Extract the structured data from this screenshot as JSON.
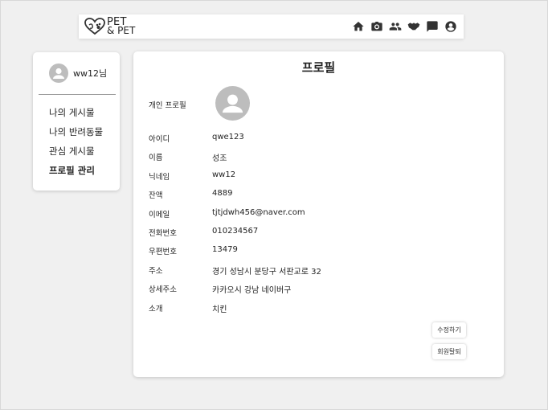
{
  "header": {
    "logo_line1": "PET",
    "logo_line2": "& PET",
    "icons": [
      "home-icon",
      "camera-box-icon",
      "people-icon",
      "handshake-icon",
      "chat-icon",
      "account-circle-icon"
    ]
  },
  "sidebar": {
    "username": "ww12님",
    "menu": [
      {
        "label": "나의 게시물",
        "active": false
      },
      {
        "label": "나의 반려동물",
        "active": false
      },
      {
        "label": "관심 게시물",
        "active": false
      },
      {
        "label": "프로필 관리",
        "active": true
      }
    ]
  },
  "profile": {
    "title": "프로필",
    "photo_label": "개인 프로필",
    "fields": [
      {
        "label": "아이디",
        "value": "qwe123"
      },
      {
        "label": "이름",
        "value": "성조"
      },
      {
        "label": "닉네임",
        "value": "ww12"
      },
      {
        "label": "잔액",
        "value": "4889"
      },
      {
        "label": "이메일",
        "value": "tjtjdwh456@naver.com"
      },
      {
        "label": "전화번호",
        "value": "010234567"
      },
      {
        "label": "우편번호",
        "value": "13479"
      },
      {
        "label": "주소",
        "value": "경기 성남시 분당구 서판교로 32"
      },
      {
        "label": "상세주소",
        "value": "카카오시 강남 네이버구"
      },
      {
        "label": "소개",
        "value": "치킨"
      }
    ],
    "edit_button": "수정하기",
    "withdraw_button": "회원탈퇴"
  },
  "colors": {
    "background": "#f0f0f0",
    "card": "#ffffff",
    "avatar": "#bdbdbd",
    "text": "#222222"
  }
}
